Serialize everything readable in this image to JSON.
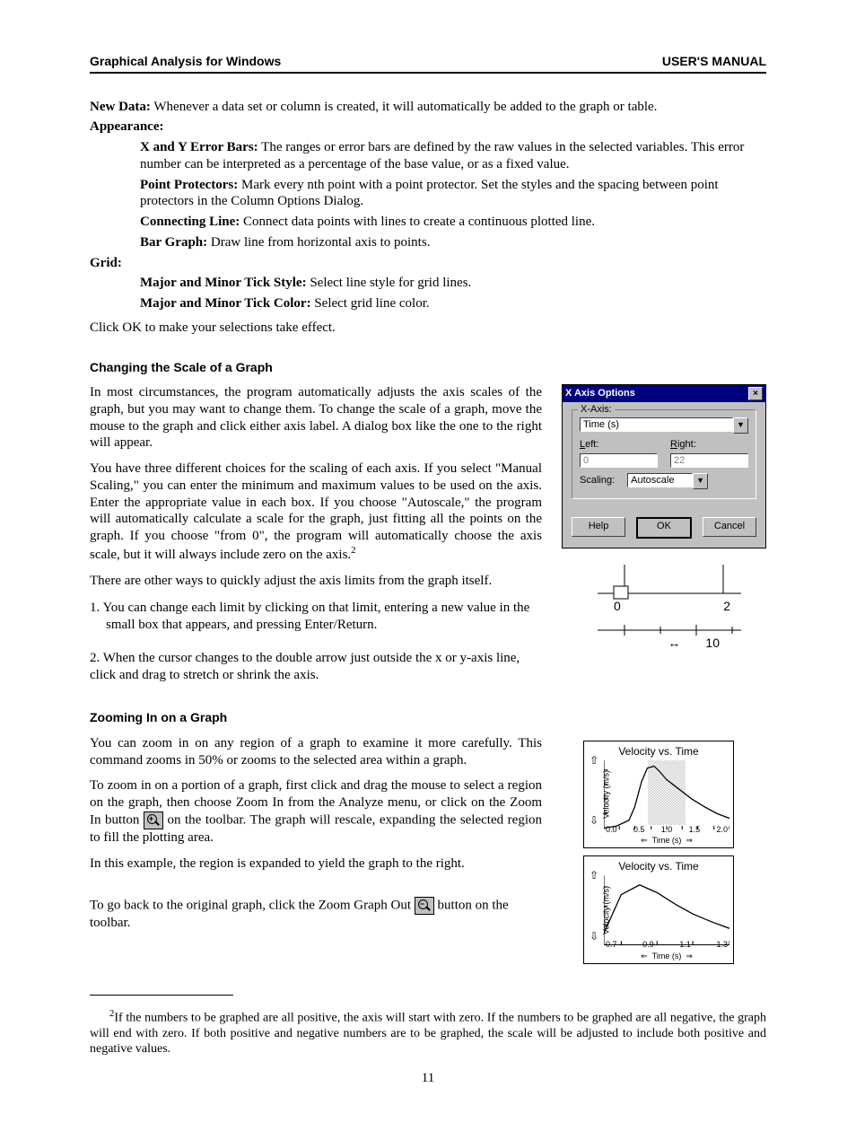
{
  "header": {
    "left": "Graphical Analysis for Windows",
    "right": "USER'S MANUAL"
  },
  "intro": {
    "new_data_label": "New Data:",
    "new_data_text": " Whenever a data set or column is created, it will automatically be added to the graph or table.",
    "appearance_label": "Appearance:",
    "xy_label": "X and Y Error Bars:",
    "xy_text": " The ranges or error bars are defined by the raw values in the selected variables. This error number can be interpreted as a percentage of the base value, or as a fixed value.",
    "pp_label": "Point Protectors:",
    "pp_text": " Mark every nth point with a point protector. Set the styles and the spacing between point protectors in the Column Options Dialog.",
    "cl_label": "Connecting Line:",
    "cl_text": " Connect data points with lines to create a continuous plotted line.",
    "bg_label": "Bar Graph:",
    "bg_text": " Draw line from horizontal axis to points.",
    "grid_label": "Grid:",
    "tick_style_label": "Major and Minor Tick Style:",
    "tick_style_text": " Select line style for grid lines.",
    "tick_color_label": "Major and Minor Tick Color:",
    "tick_color_text": " Select grid line color.",
    "click_ok": "Click OK to make your selections take effect."
  },
  "scale": {
    "heading": "Changing the Scale of a Graph",
    "p1": "In most circumstances, the program automatically adjusts the axis scales of the graph, but you may want to change them. To change the scale of a graph, move the mouse to the graph and click either axis label. A dialog box like the one to the right will appear.",
    "p2_a": "You have three different choices for the scaling of each axis. If you select \"Manual Scaling,\" you can enter the minimum and maximum values to be used on the axis. Enter the appropriate value in each box. If you choose \"Autoscale,\" the program will automatically calculate a scale for the graph, just fitting all the points on the graph. If you choose \"from 0\", the program will automatically choose the axis scale, but it will always include zero on the axis.",
    "p2_sup": "2",
    "p3": "There are other ways to quickly adjust the axis limits from the graph itself.",
    "li1": "1. You can change each limit by clicking on that limit, entering a new value in the small box that appears, and pressing Enter/Return.",
    "li2": "2. When the cursor changes to the double arrow just outside the x or y-axis line, click and drag to stretch or shrink the axis."
  },
  "dialog": {
    "title": "X Axis Options",
    "close": "×",
    "group": "X-Axis:",
    "field_main": "Time (s)",
    "left_label": "Left:",
    "left_val": "0",
    "right_label": "Right:",
    "right_val": "22",
    "scaling_label": "Scaling:",
    "scaling_val": "Autoscale",
    "help": "Help",
    "ok": "OK",
    "cancel": "Cancel"
  },
  "axis_fig": {
    "left": "0",
    "right": "2",
    "tick": "10",
    "arrow": "↔"
  },
  "zoom": {
    "heading": "Zooming In on a Graph",
    "p1": "You can zoom in on any region of a graph to examine it more carefully. This command zooms in 50% or zooms to the selected area within a graph.",
    "p2": "To zoom in on a portion of a graph, first click and drag the mouse to select a region on the graph, then choose Zoom In from the Analyze menu, or click on the Zoom In button",
    "p3": " on the toolbar. The graph will rescale, expanding the selected region to fill the plotting area.",
    "p4": "In this example, the region is expanded to yield the graph to the right.",
    "p5a": "To go back to the original graph, click the Zoom Graph Out ",
    "p5b": " button on the toolbar."
  },
  "charts": {
    "title": "Velocity vs. Time",
    "ylabel": "Velocity (m/s)",
    "xlabel": "Time (s)",
    "ticks_full": [
      "0.0",
      "0.5",
      "1.0",
      "1.5",
      "2.0"
    ],
    "ticks_zoom": [
      "0.7",
      "0.9",
      "1.1",
      "1.3"
    ]
  },
  "chart_data": [
    {
      "type": "line",
      "title": "Velocity vs. Time",
      "xlabel": "Time (s)",
      "ylabel": "Velocity (m/s)",
      "xlim": [
        0.0,
        2.0
      ],
      "x": [
        0.0,
        0.2,
        0.4,
        0.5,
        0.6,
        0.7,
        0.8,
        0.9,
        1.0,
        1.2,
        1.4,
        1.6,
        1.8,
        2.0
      ],
      "values": [
        0.0,
        0.1,
        0.3,
        0.8,
        2.0,
        3.2,
        3.4,
        3.0,
        2.5,
        2.0,
        1.5,
        1.1,
        0.8,
        0.5
      ],
      "selection_x": [
        0.7,
        1.3
      ]
    },
    {
      "type": "line",
      "title": "Velocity vs. Time",
      "xlabel": "Time (s)",
      "ylabel": "Velocity (m/s)",
      "xlim": [
        0.6,
        1.3
      ],
      "x": [
        0.6,
        0.7,
        0.8,
        0.9,
        1.0,
        1.1,
        1.2,
        1.3
      ],
      "values": [
        2.0,
        3.2,
        3.4,
        3.0,
        2.5,
        2.25,
        2.0,
        1.75
      ]
    }
  ],
  "footnote": {
    "sup": "2",
    "text": "If the numbers to be graphed are all positive, the axis will start with zero. If the numbers to be graphed are all negative, the graph will end with zero. If both positive and negative numbers are to be graphed, the scale will be adjusted to include both positive and negative values."
  },
  "page": "11"
}
